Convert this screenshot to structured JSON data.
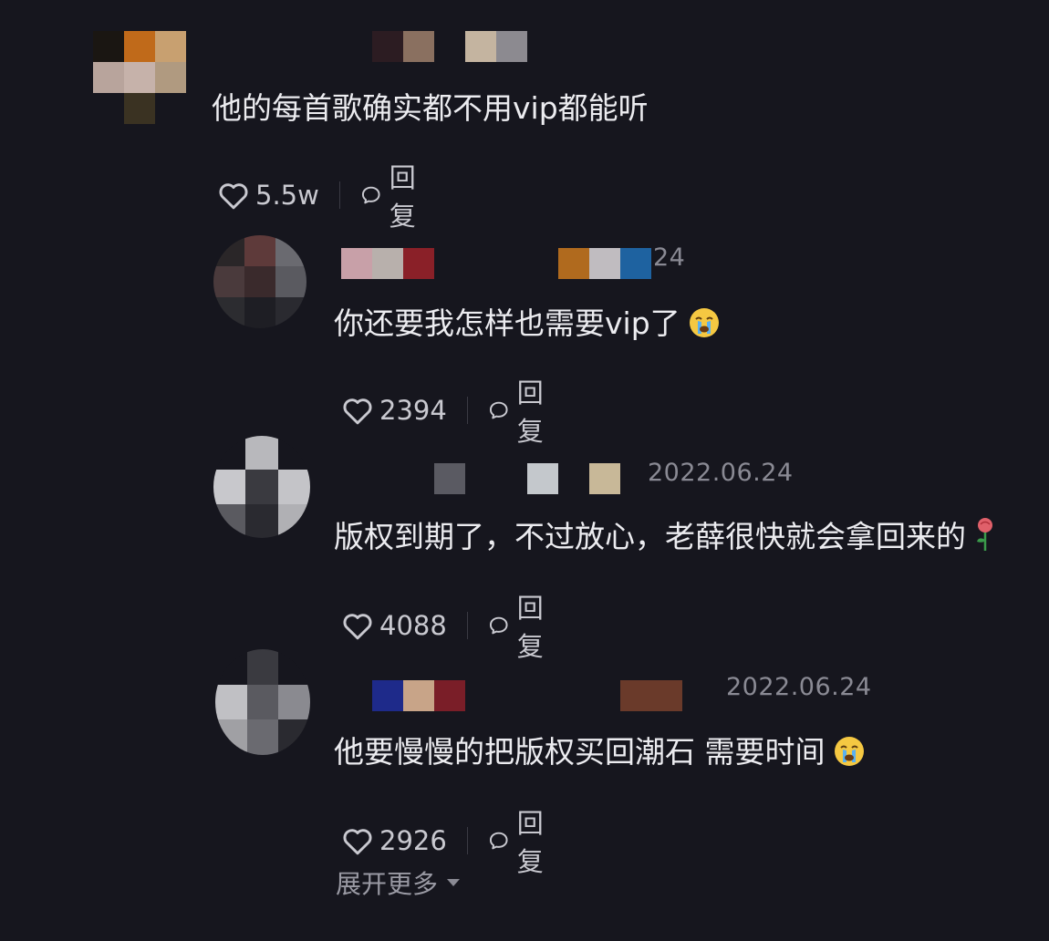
{
  "comments": [
    {
      "text": "他的每首歌确实都不用vip都能听",
      "likes": "5.5w",
      "reply": "回复"
    },
    {
      "date": "24",
      "text": "你还要我怎样也需要vip了",
      "emoji": "crying-face",
      "likes": "2394",
      "reply": "回复"
    },
    {
      "date": "2022.06.24",
      "text": "版权到期了，不过放心，老薛很快就会拿回来的",
      "emoji": "rose",
      "likes": "4088",
      "reply": "回复"
    },
    {
      "date": "2022.06.24",
      "text": "他要慢慢的把版权买回潮石 需要时间",
      "emoji": "crying-face",
      "likes": "2926",
      "reply": "回复"
    }
  ],
  "expand_label": "展开更多",
  "icons": [
    "heart-icon",
    "comment-bubble-icon",
    "chevron-down-icon"
  ],
  "colors": {
    "background": "#16161e",
    "text": "#ececf0",
    "muted": "#8a8a94"
  }
}
